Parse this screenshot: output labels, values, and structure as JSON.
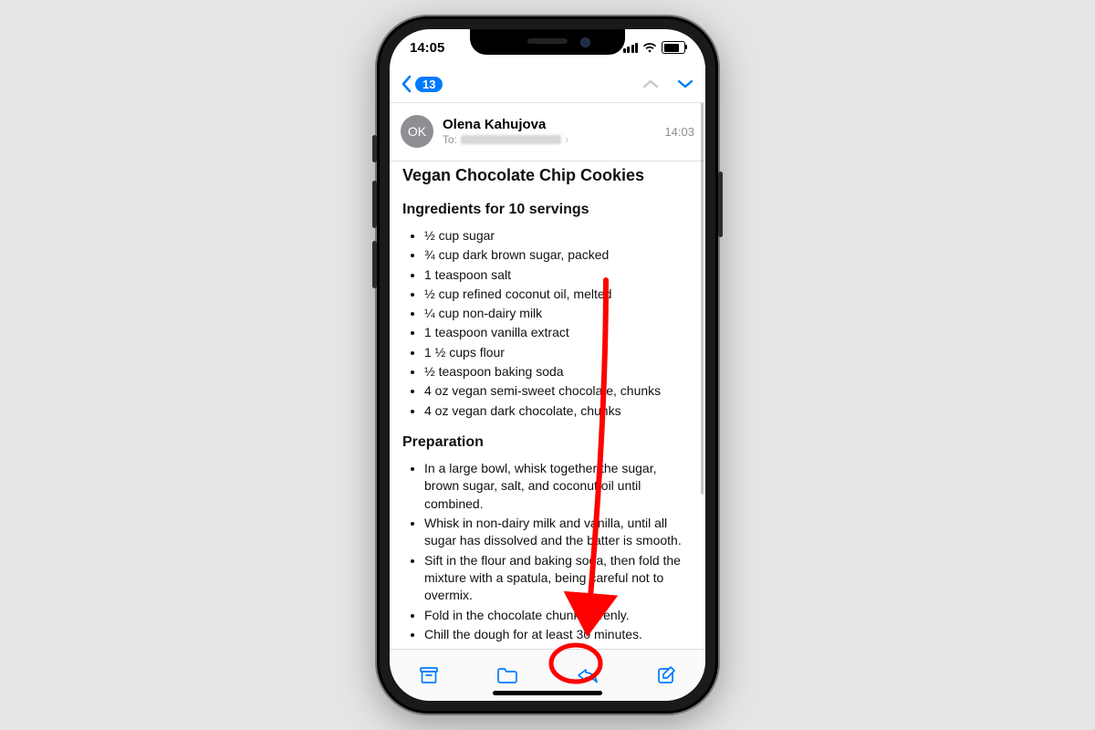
{
  "status": {
    "time": "14:05"
  },
  "nav": {
    "badge": "13"
  },
  "header": {
    "avatar_initials": "OK",
    "sender": "Olena Kahujova",
    "to_label": "To:",
    "time": "14:03"
  },
  "email": {
    "title": "Vegan Chocolate Chip Cookies",
    "ingredients_heading": "Ingredients for 10 servings",
    "ingredients": [
      "½ cup sugar",
      "¾ cup dark brown sugar, packed",
      "1 teaspoon salt",
      "½ cup refined coconut oil, melted",
      "¼ cup non-dairy milk",
      "1 teaspoon vanilla extract",
      "1 ½ cups flour",
      "½ teaspoon baking soda",
      "4 oz vegan semi-sweet chocolate, chunks",
      "4 oz vegan dark chocolate, chunks"
    ],
    "preparation_heading": "Preparation",
    "preparation": [
      "In a large bowl, whisk together the sugar, brown sugar, salt, and coconut oil until combined.",
      "Whisk in non-dairy milk and vanilla, until all sugar has dissolved and the batter is smooth.",
      "Sift in the flour and baking soda, then fold the mixture with a spatula, being careful not to overmix.",
      "Fold in the chocolate chunks evenly.",
      "Chill the dough for at least 30 minutes."
    ]
  },
  "toolbar_icons": {
    "archive": "archive-icon",
    "folder": "folder-icon",
    "reply": "reply-icon",
    "compose": "compose-icon"
  },
  "annotation": {
    "color": "#ff0000",
    "target": "reply-button"
  }
}
